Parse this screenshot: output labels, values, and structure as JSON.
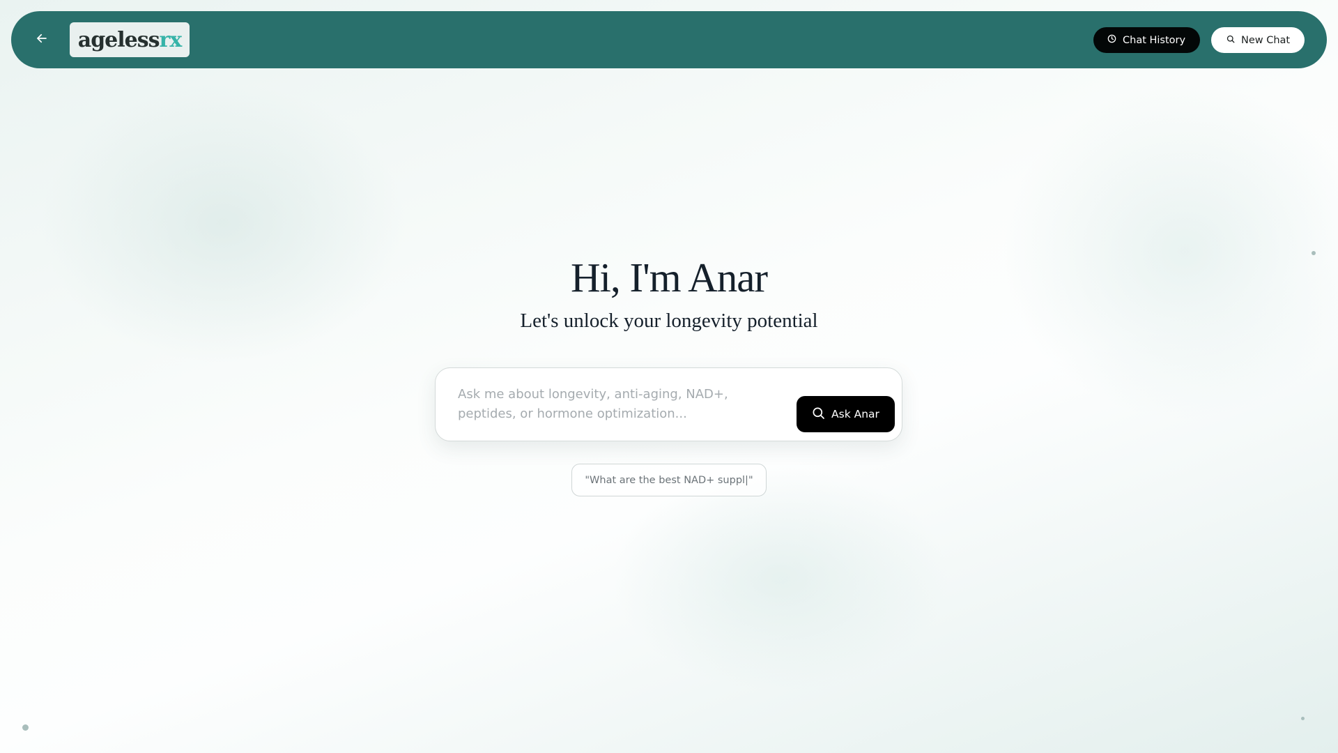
{
  "header": {
    "back_icon": "arrow-left-icon",
    "logo": {
      "part1": "ageless",
      "part2": "rx"
    },
    "chat_history_label": "Chat History",
    "chat_history_icon": "clock-icon",
    "new_chat_label": "New Chat",
    "new_chat_icon": "search-icon"
  },
  "hero": {
    "title": "Hi, I'm Anar",
    "subtitle": "Let's unlock your longevity potential"
  },
  "ask": {
    "placeholder": "Ask me about longevity, anti-aging, NAD+, peptides, or hormone optimization...",
    "value": "",
    "button_label": "Ask Anar",
    "button_icon": "search-icon"
  },
  "suggestion": {
    "text": "\"What are the best NAD+ suppl|\""
  },
  "colors": {
    "header_bg": "#29706c",
    "logo_accent": "#36b3a8",
    "primary_button": "#000000"
  }
}
